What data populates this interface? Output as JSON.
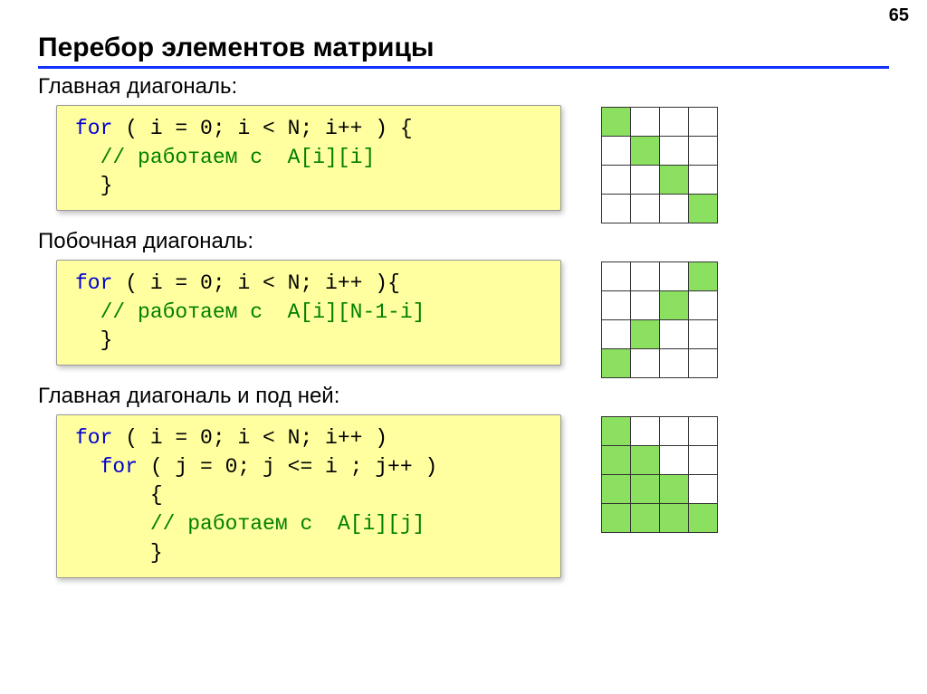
{
  "pageNumber": "65",
  "title": "Перебор элементов матрицы",
  "sections": {
    "s1": {
      "label": "Главная диагональ:",
      "code": {
        "l1a": "for",
        "l1b": " ( i = 0; i < N; i++ ) {",
        "l2": "  // работаем с  A[i][i]",
        "l3": "  }"
      },
      "matrix": [
        [
          1,
          0,
          0,
          0
        ],
        [
          0,
          1,
          0,
          0
        ],
        [
          0,
          0,
          1,
          0
        ],
        [
          0,
          0,
          0,
          1
        ]
      ]
    },
    "s2": {
      "label": "Побочная диагональ:",
      "code": {
        "l1a": "for",
        "l1b": " ( i = 0; i < N; i++ ){",
        "l2": "  // работаем с  A[i][N-1-i]",
        "l3": "  }"
      },
      "matrix": [
        [
          0,
          0,
          0,
          1
        ],
        [
          0,
          0,
          1,
          0
        ],
        [
          0,
          1,
          0,
          0
        ],
        [
          1,
          0,
          0,
          0
        ]
      ]
    },
    "s3": {
      "label": "Главная диагональ и под ней:",
      "code": {
        "l1a": "for",
        "l1b": " ( i = 0; i < N; i++ )",
        "l2a": "  for",
        "l2b": " ( j = 0; j <= i ; j++ )",
        "l3": "      {",
        "l4": "      // работаем с  A[i][j]",
        "l5": "      }"
      },
      "matrix": [
        [
          1,
          0,
          0,
          0
        ],
        [
          1,
          1,
          0,
          0
        ],
        [
          1,
          1,
          1,
          0
        ],
        [
          1,
          1,
          1,
          1
        ]
      ]
    }
  }
}
